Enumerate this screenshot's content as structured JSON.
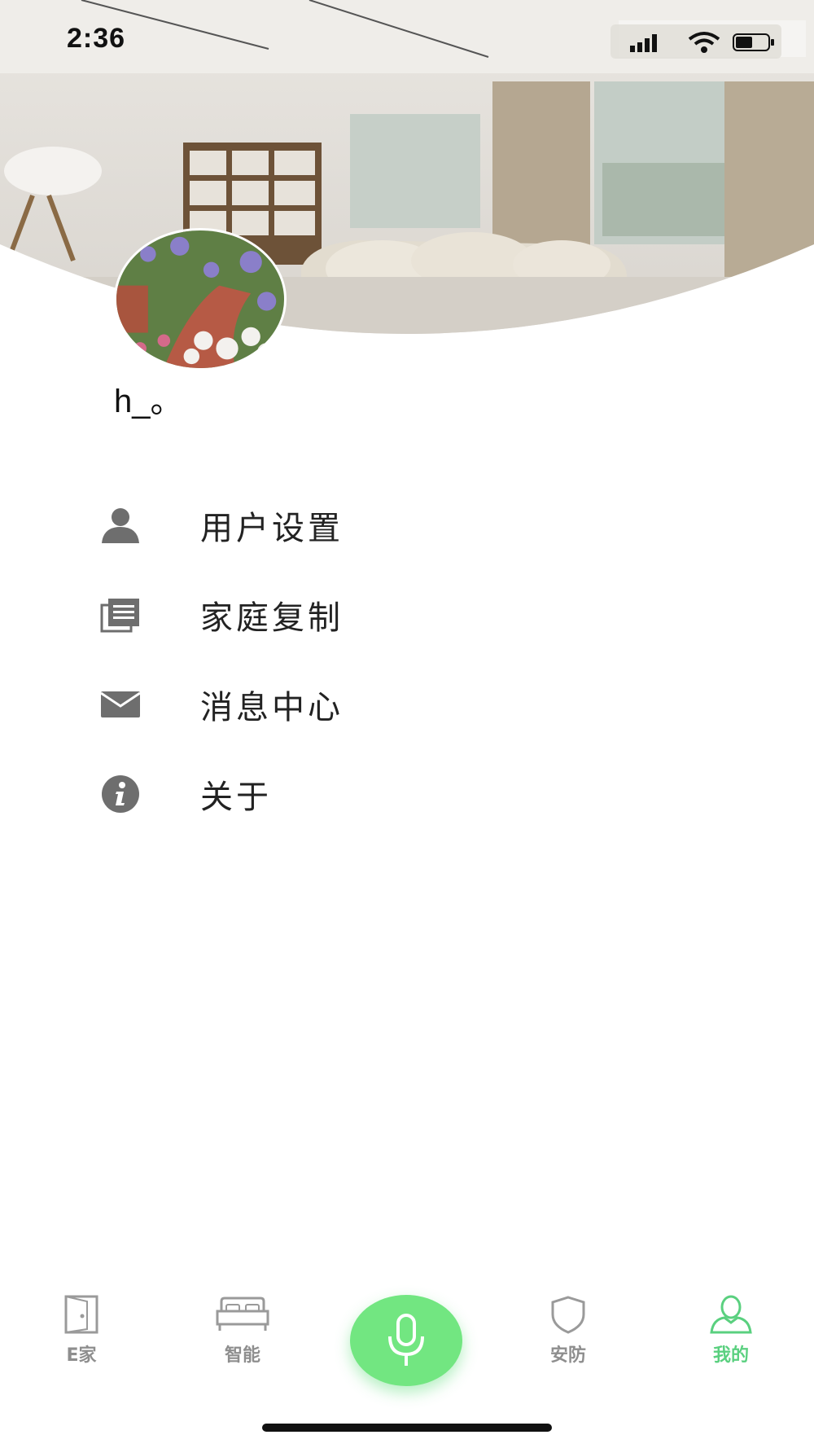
{
  "status_bar": {
    "time": "2:36"
  },
  "profile": {
    "username": "h_。"
  },
  "menu": [
    {
      "label": "用户设置",
      "icon": "person-icon"
    },
    {
      "label": "家庭复制",
      "icon": "documents-icon"
    },
    {
      "label": "消息中心",
      "icon": "mail-icon"
    },
    {
      "label": "关于",
      "icon": "info-icon"
    }
  ],
  "tabs": [
    {
      "label": "E家",
      "icon": "door-icon",
      "active": false
    },
    {
      "label": "智能",
      "icon": "bed-icon",
      "active": false
    },
    {
      "label": "安防",
      "icon": "shield-icon",
      "active": false
    },
    {
      "label": "我的",
      "icon": "user-icon",
      "active": true
    }
  ],
  "mic_button": {
    "icon": "microphone-icon"
  },
  "colors": {
    "accent": "#5ad07f",
    "mic_bg": "#72e681",
    "icon_gray": "#6e6e6e"
  }
}
